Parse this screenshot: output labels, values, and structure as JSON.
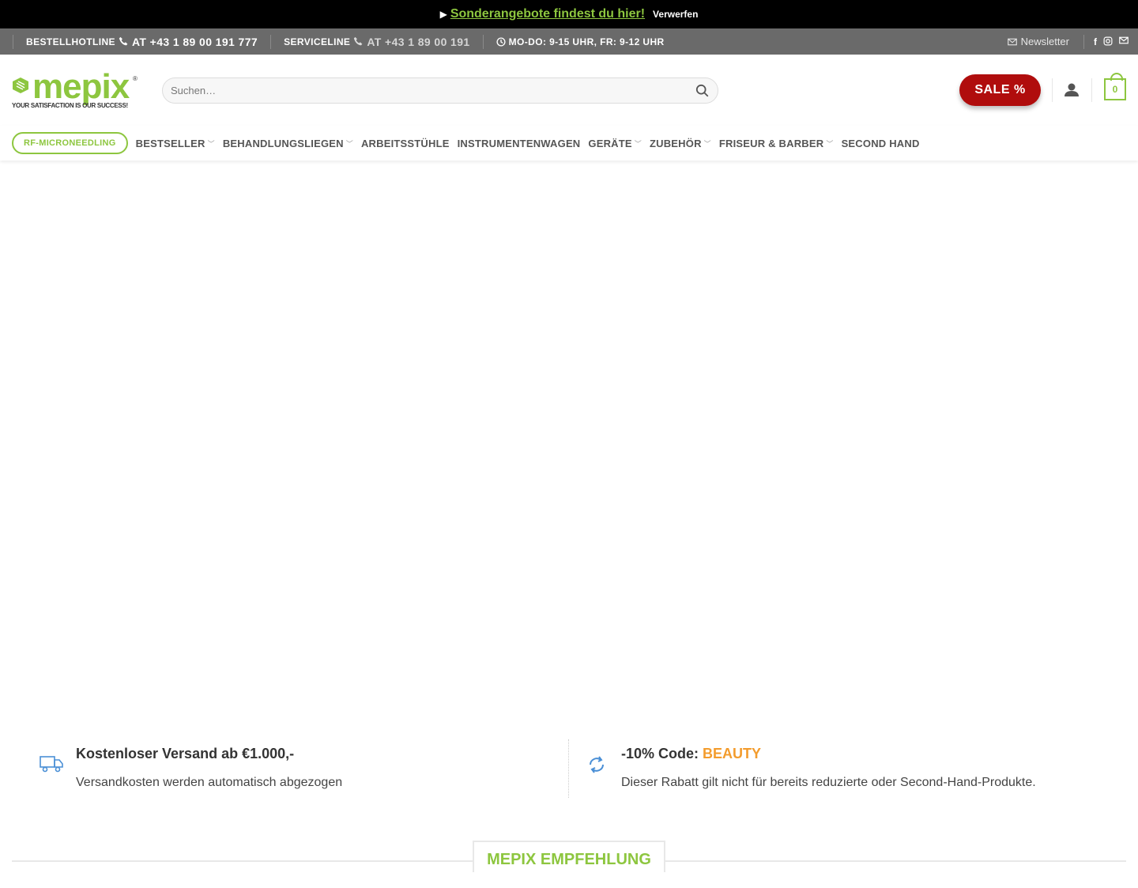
{
  "promo": {
    "arrow": "▶",
    "link_text": "Sonderangebote findest du hier!",
    "dismiss": "Verwerfen"
  },
  "topbar": {
    "order_label": "BESTELLHOTLINE",
    "order_number": "AT +43 1 89 00 191 777",
    "service_label": "SERVICELINE",
    "service_number": "AT +43 1 89 00 191",
    "hours": "MO-DO: 9-15 UHR, FR: 9-12 UHR",
    "newsletter": "Newsletter",
    "social": [
      "facebook-icon",
      "instagram-icon",
      "email-icon"
    ]
  },
  "header": {
    "logo_word": "mepix",
    "logo_reg": "®",
    "logo_tagline": "YOUR SATISFACTION IS OUR SUCCESS!",
    "search_placeholder": "Suchen…",
    "sale_label": "SALE %",
    "cart_count": "0"
  },
  "nav": {
    "pill": "RF-MICRONEEDLING",
    "items": [
      {
        "label": "BESTSELLER",
        "dropdown": true
      },
      {
        "label": "BEHANDLUNGSLIEGEN",
        "dropdown": true
      },
      {
        "label": "ARBEITSSTÜHLE",
        "dropdown": false
      },
      {
        "label": "INSTRUMENTENWAGEN",
        "dropdown": false
      },
      {
        "label": "GERÄTE",
        "dropdown": true
      },
      {
        "label": "ZUBEHÖR",
        "dropdown": true
      },
      {
        "label": "FRISEUR & BARBER",
        "dropdown": true
      },
      {
        "label": "SECOND HAND",
        "dropdown": false
      }
    ]
  },
  "features": {
    "shipping_title": "Kostenloser Versand ab €1.000,-",
    "shipping_desc": "Versandkosten werden automatisch abgezogen",
    "discount_title_prefix": "-10% Code: ",
    "discount_code": "BEAUTY",
    "discount_desc": "Dieser Rabatt gilt nicht für bereits reduzierte oder Second-Hand-Produkte."
  },
  "section": {
    "title": "MEPIX EMPFEHLUNG"
  },
  "colors": {
    "brand_green": "#8dc63f",
    "sale_red": "#b00d0d",
    "accent_orange": "#f39c2d",
    "topbar_gray": "#6a6a6a"
  }
}
